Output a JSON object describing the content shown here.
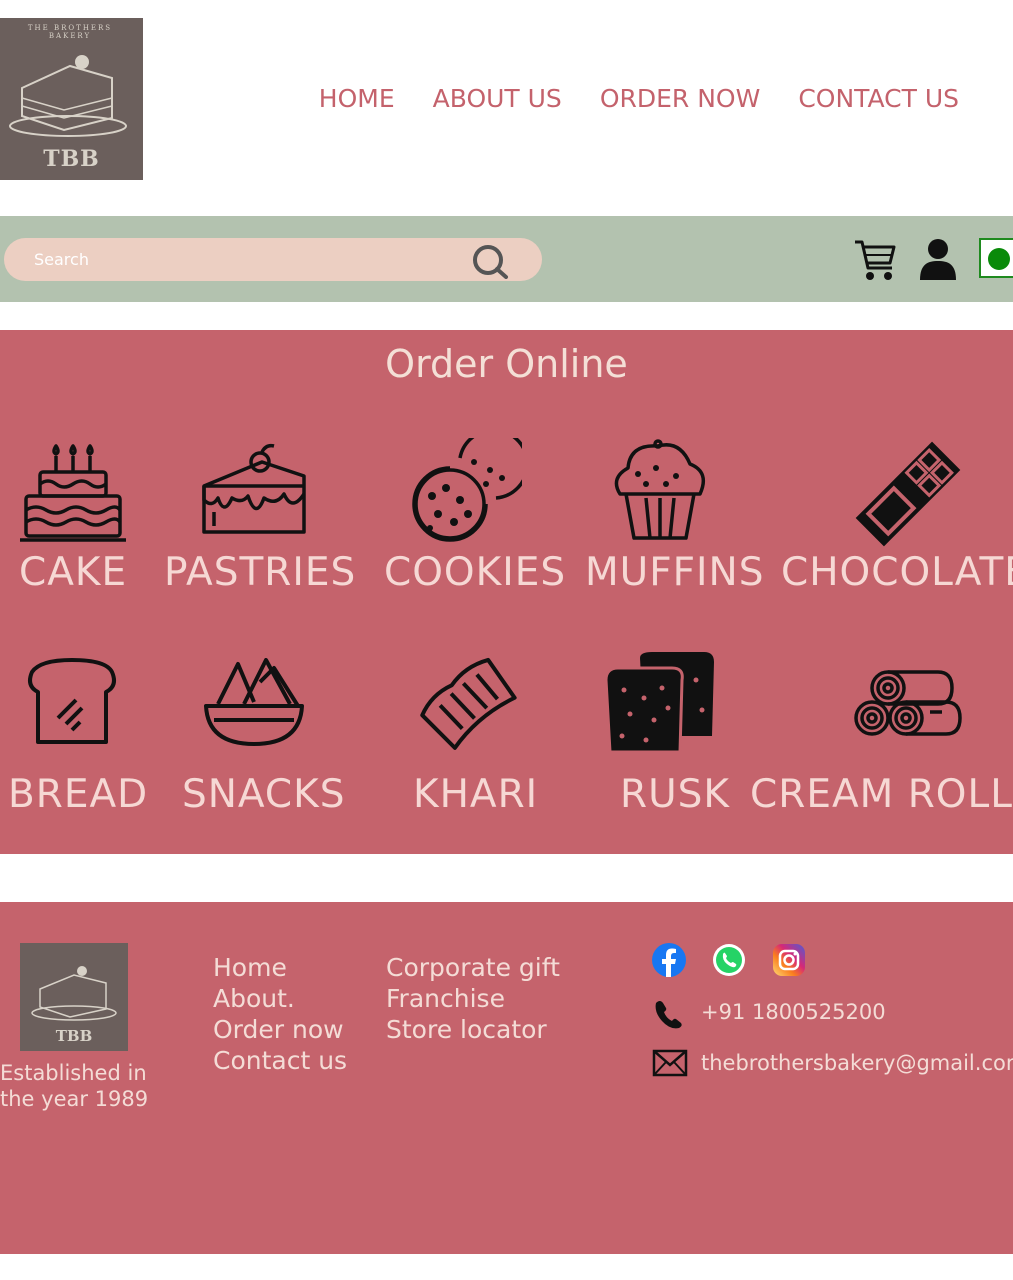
{
  "brand": {
    "logo_text": "TBB",
    "logo_arc_text": "THE BROTHERS BAKERY"
  },
  "nav": {
    "items": [
      "HOME",
      "ABOUT US",
      "ORDER NOW",
      "CONTACT US"
    ]
  },
  "search": {
    "placeholder": "Search"
  },
  "icons": {
    "search": "search-icon",
    "cart": "cart-icon",
    "user": "user-icon",
    "toggle": "toggle-switch"
  },
  "order": {
    "title": "Order Online",
    "categories_row1": [
      "CAKE",
      "PASTRIES",
      "COOKIES",
      "MUFFINS",
      "CHOCOLATE"
    ],
    "categories_row2": [
      "BREAD",
      "SNACKS",
      "KHARI",
      "RUSK",
      "CREAM ROLLS"
    ]
  },
  "footer": {
    "logo_text": "TBB",
    "established_line1": "Established in",
    "established_line2": "the year 1989",
    "links_col1": [
      "Home",
      "About.",
      "Order now",
      "Contact us"
    ],
    "links_col2": [
      "Corporate gift",
      "Franchise",
      "Store locator"
    ],
    "phone": "+91 1800525200",
    "email": "thebrothersbakery@gmail.com"
  },
  "colors": {
    "accent": "#c5636c",
    "nav_text": "#c4626c",
    "bar": "#b3c2af",
    "search_bg": "#eccfc2",
    "logo_bg": "#6b5f5c",
    "toggle_green": "#0a8a0a"
  }
}
